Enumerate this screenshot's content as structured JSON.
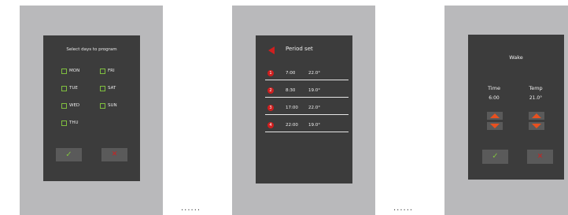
{
  "colors": {
    "device": "#b9b9bb",
    "screen": "#3c3c3c",
    "accent_green": "#7fbf3f",
    "accent_red": "#cf1f1f",
    "arrow_orange": "#e8501f"
  },
  "ellipsis": "......",
  "day_select": {
    "title": "Select days to program",
    "days": [
      {
        "label": "MON",
        "checked": false
      },
      {
        "label": "FRI",
        "checked": false
      },
      {
        "label": "TUE",
        "checked": false
      },
      {
        "label": "SAT",
        "checked": false
      },
      {
        "label": "WED",
        "checked": false
      },
      {
        "label": "SUN",
        "checked": false
      },
      {
        "label": "THU",
        "checked": false
      }
    ],
    "confirm_icon": "checkmark-icon",
    "cancel_icon": "cross-icon"
  },
  "period_set": {
    "title": "Period set",
    "back_icon": "back-arrow-icon",
    "periods": [
      {
        "number": "1",
        "time": "7:00",
        "temp": "22.0°"
      },
      {
        "number": "2",
        "time": "8:30",
        "temp": "19.0°"
      },
      {
        "number": "3",
        "time": "17:00",
        "temp": "22.0°"
      },
      {
        "number": "4",
        "time": "22:00",
        "temp": "19.0°"
      }
    ]
  },
  "wake": {
    "title": "Wake",
    "time_label": "Time",
    "time_value": "6:00",
    "temp_label": "Temp",
    "temp_value": "21.0°",
    "confirm_icon": "checkmark-icon",
    "cancel_icon": "cross-icon"
  }
}
